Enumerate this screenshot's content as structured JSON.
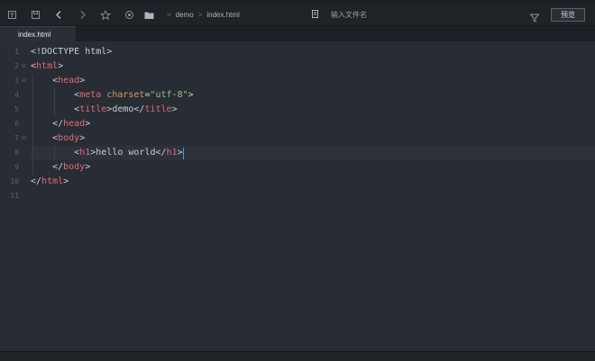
{
  "toolbar": {
    "icons": [
      "new-file-icon",
      "save-icon",
      "back-icon",
      "forward-icon",
      "star-icon",
      "target-icon",
      "folder-icon"
    ],
    "breadcrumb": [
      "demo",
      "index.html"
    ],
    "search_placeholder": "输入文件名",
    "preview_label": "预览"
  },
  "tabs": [
    {
      "label": "index.html"
    }
  ],
  "editor": {
    "line_numbers": [
      "1",
      "2",
      "3",
      "4",
      "5",
      "6",
      "7",
      "8",
      "9",
      "10",
      "11"
    ],
    "lines": [
      {
        "indent": 0,
        "tokens": [
          {
            "t": "<!DOCTYPE html>",
            "c": "plain"
          }
        ]
      },
      {
        "indent": 0,
        "tokens": [
          {
            "t": "<",
            "c": "plain"
          },
          {
            "t": "html",
            "c": "tag"
          },
          {
            "t": ">",
            "c": "plain"
          }
        ]
      },
      {
        "indent": 1,
        "tokens": [
          {
            "t": "<",
            "c": "plain"
          },
          {
            "t": "head",
            "c": "tag"
          },
          {
            "t": ">",
            "c": "plain"
          }
        ]
      },
      {
        "indent": 2,
        "tokens": [
          {
            "t": "<",
            "c": "plain"
          },
          {
            "t": "meta",
            "c": "tag"
          },
          {
            "t": " ",
            "c": "plain"
          },
          {
            "t": "charset",
            "c": "attr"
          },
          {
            "t": "=",
            "c": "plain"
          },
          {
            "t": "\"utf-8\"",
            "c": "str"
          },
          {
            "t": ">",
            "c": "plain"
          }
        ]
      },
      {
        "indent": 2,
        "tokens": [
          {
            "t": "<",
            "c": "plain"
          },
          {
            "t": "title",
            "c": "tag"
          },
          {
            "t": ">demo</",
            "c": "plain"
          },
          {
            "t": "title",
            "c": "tag"
          },
          {
            "t": ">",
            "c": "plain"
          }
        ]
      },
      {
        "indent": 1,
        "tokens": [
          {
            "t": "</",
            "c": "plain"
          },
          {
            "t": "head",
            "c": "tag"
          },
          {
            "t": ">",
            "c": "plain"
          }
        ]
      },
      {
        "indent": 1,
        "tokens": [
          {
            "t": "<",
            "c": "plain"
          },
          {
            "t": "body",
            "c": "tag"
          },
          {
            "t": ">",
            "c": "plain"
          }
        ]
      },
      {
        "indent": 2,
        "tokens": [
          {
            "t": "<",
            "c": "plain"
          },
          {
            "t": "h1",
            "c": "tag"
          },
          {
            "t": ">hello world</",
            "c": "plain"
          },
          {
            "t": "h1",
            "c": "tag"
          },
          {
            "t": ">",
            "c": "plain"
          }
        ]
      },
      {
        "indent": 1,
        "tokens": [
          {
            "t": "</",
            "c": "plain"
          },
          {
            "t": "body",
            "c": "tag"
          },
          {
            "t": ">",
            "c": "plain"
          }
        ]
      },
      {
        "indent": 0,
        "tokens": [
          {
            "t": "</",
            "c": "plain"
          },
          {
            "t": "html",
            "c": "tag"
          },
          {
            "t": ">",
            "c": "plain"
          }
        ]
      },
      {
        "indent": 0,
        "tokens": []
      }
    ],
    "fold_lines": [
      "2",
      "3",
      "7"
    ],
    "active_line": "8"
  },
  "colors": {
    "tag": "#e06c75",
    "attr": "#d19a66",
    "string": "#98c379",
    "background": "#282c34",
    "cursor": "#528bff"
  }
}
